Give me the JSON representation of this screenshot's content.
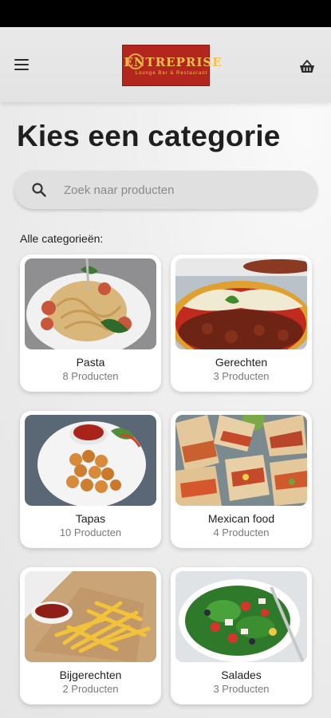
{
  "header": {
    "logo_title": "ENTREPRISE",
    "logo_subtitle": "Lounge Bar & Restaurant",
    "menu_icon": "hamburger-menu-icon",
    "basket_icon": "basket-icon"
  },
  "page": {
    "title": "Kies een categorie"
  },
  "search": {
    "placeholder": "Zoek naar producten",
    "icon": "search-icon"
  },
  "categories_label": "Alle categorieën:",
  "categories": [
    {
      "name": "Pasta",
      "count": "8 Producten"
    },
    {
      "name": "Gerechten",
      "count": "3 Producten"
    },
    {
      "name": "Tapas",
      "count": "10 Producten"
    },
    {
      "name": "Mexican food",
      "count": "4 Producten"
    },
    {
      "name": "Bijgerechten",
      "count": "2 Producten"
    },
    {
      "name": "Salades",
      "count": "3 Producten"
    }
  ],
  "colors": {
    "logo_bg": "#b3261e",
    "logo_text": "#f3c04d",
    "background": "#ececec"
  }
}
